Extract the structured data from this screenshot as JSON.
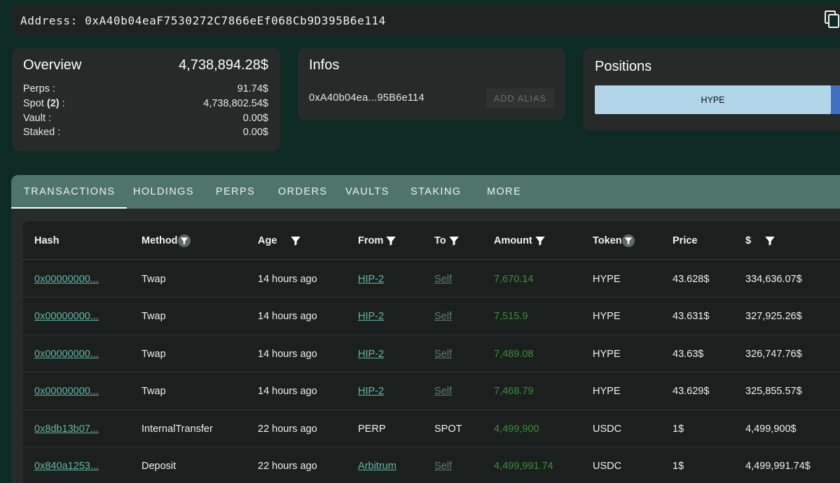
{
  "address_bar": {
    "label": "Address:",
    "address": "0xA40b04eaF7530272C7866eEf068Cb9D395B6e114"
  },
  "overview": {
    "title": "Overview",
    "total": "4,738,894.28$",
    "rows": [
      {
        "label": "Perps :",
        "value": "91.74$"
      },
      {
        "label_prefix": "Spot ",
        "label_count": "(2)",
        "label_suffix": " :",
        "value": "4,738,802.54$"
      },
      {
        "label": "Vault :",
        "value": "0.00$"
      },
      {
        "label": "Staked :",
        "value": "0.00$"
      }
    ]
  },
  "infos": {
    "title": "Infos",
    "short_address": "0xA40b04ea...95B6e114",
    "add_alias_label": "ADD ALIAS"
  },
  "positions": {
    "title": "Positions",
    "bar_label": "HYPE",
    "bar_color": "#b1d6ea",
    "second_bar_color": "#3f6fc8"
  },
  "tabs": [
    "TRANSACTIONS",
    "HOLDINGS",
    "PERPS",
    "ORDERS",
    "VAULTS",
    "STAKING",
    "MORE"
  ],
  "table": {
    "headers": [
      "Hash",
      "Method",
      "Age",
      "From",
      "To",
      "Amount",
      "Token",
      "Price",
      "$"
    ],
    "rows": [
      {
        "hash": "0x00000000...",
        "method": "Twap",
        "age": "14 hours ago",
        "from": "HIP-2",
        "to": "Self",
        "amount": "7,670.14",
        "token": "HYPE",
        "price": "43.628$",
        "usd": "334,636.07$"
      },
      {
        "hash": "0x00000000...",
        "method": "Twap",
        "age": "14 hours ago",
        "from": "HIP-2",
        "to": "Self",
        "amount": "7,515.9",
        "token": "HYPE",
        "price": "43.631$",
        "usd": "327,925.26$"
      },
      {
        "hash": "0x00000000...",
        "method": "Twap",
        "age": "14 hours ago",
        "from": "HIP-2",
        "to": "Self",
        "amount": "7,489.08",
        "token": "HYPE",
        "price": "43.63$",
        "usd": "326,747.76$"
      },
      {
        "hash": "0x00000000...",
        "method": "Twap",
        "age": "14 hours ago",
        "from": "HIP-2",
        "to": "Self",
        "amount": "7,468.79",
        "token": "HYPE",
        "price": "43.629$",
        "usd": "325,855.57$"
      },
      {
        "hash": "0x8db13b07...",
        "method": "InternalTransfer",
        "age": "22 hours ago",
        "from": "PERP",
        "to": "SPOT",
        "amount": "4,499,900",
        "token": "USDC",
        "price": "1$",
        "usd": "4,499,900$"
      },
      {
        "hash": "0x840a1253...",
        "method": "Deposit",
        "age": "22 hours ago",
        "from": "Arbitrum",
        "to": "Self",
        "amount": "4,499,991.74",
        "token": "USDC",
        "price": "1$",
        "usd": "4,499,991.74$"
      }
    ]
  },
  "colors": {
    "background": "#0d2a25",
    "tab_bar": "#4f756a",
    "link": "#62b8a8",
    "amount": "#3f8d3c"
  }
}
